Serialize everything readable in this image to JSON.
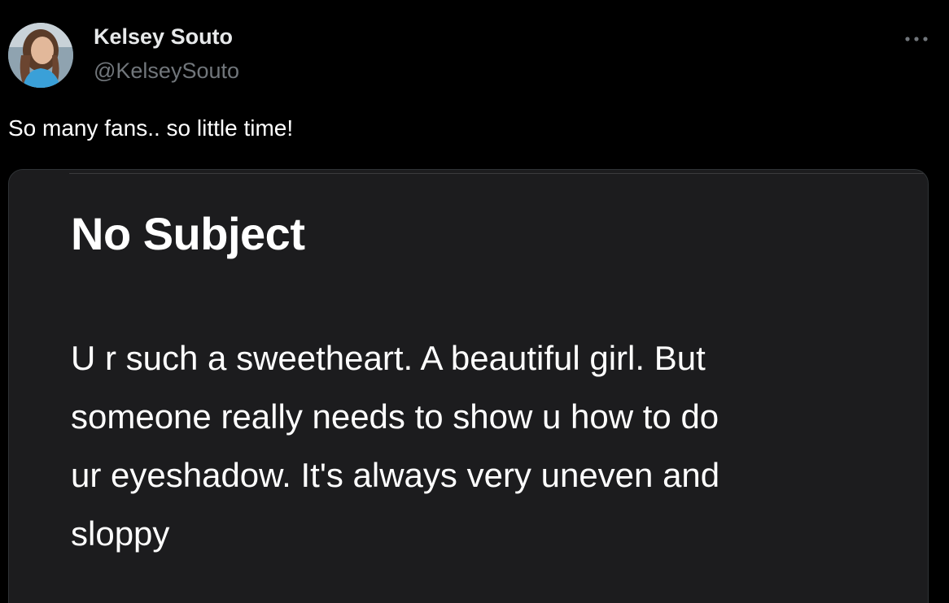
{
  "author": {
    "display_name": "Kelsey Souto",
    "handle": "@KelseySouto",
    "avatar_icon": "profile-photo"
  },
  "more_icon": "more-horizontal-icon",
  "tweet": {
    "text": "So many fans.. so little time!"
  },
  "media": {
    "subject": "No Subject",
    "body_lines": [
      "U r such a sweetheart. A beautiful girl. But",
      "someone really needs to show u how to do",
      "ur eyeshadow. It's always very uneven and",
      "sloppy"
    ]
  },
  "colors": {
    "background": "#000000",
    "primary_text": "#e7e9ea",
    "secondary_text": "#71767b",
    "card_background": "#1c1c1e"
  }
}
